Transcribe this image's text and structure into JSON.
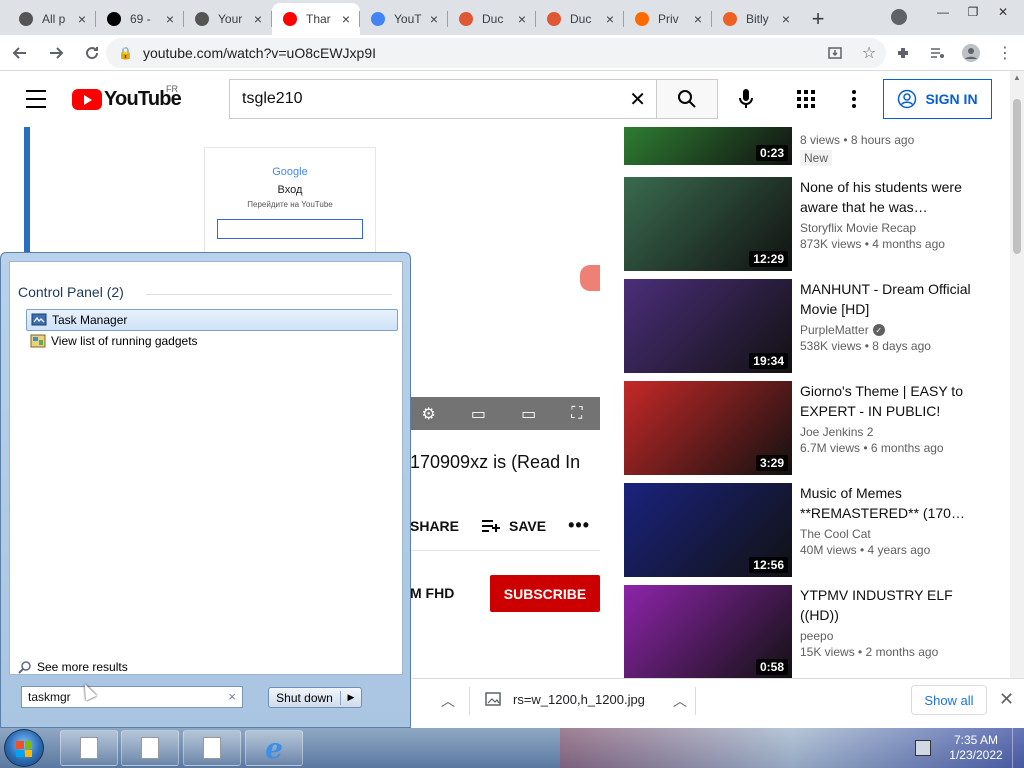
{
  "browser": {
    "tabs": [
      {
        "title": "All p",
        "icon": "tor-icon"
      },
      {
        "title": "69 -",
        "icon": "wikipedia-icon"
      },
      {
        "title": "Your",
        "icon": "tor-icon"
      },
      {
        "title": "Thar",
        "icon": "youtube-icon",
        "active": true
      },
      {
        "title": "YouT",
        "icon": "google-icon"
      },
      {
        "title": "Duc",
        "icon": "duckduckgo-icon"
      },
      {
        "title": "Duc",
        "icon": "duck-icon"
      },
      {
        "title": "Priv",
        "icon": "privacy-icon"
      },
      {
        "title": "Bitly",
        "icon": "bitly-icon"
      }
    ],
    "close_glyph": "×",
    "new_tab_glyph": "+",
    "url": "youtube.com/watch?v=uO8cEWJxp9I",
    "window_controls": [
      "—",
      "❐",
      "✕"
    ]
  },
  "youtube": {
    "logo_text": "YouTube",
    "country_code": "FR",
    "search_value": "tsgle210",
    "signin_label": "SIGN IN",
    "video_title_partial": "170909xz is (Read In",
    "actions": {
      "share": "SHARE",
      "save": "SAVE",
      "more": "•••"
    },
    "channel_partial": "M FHD",
    "subscribe_label": "SUBSCRIBE",
    "player_login": {
      "brand": "Google",
      "heading": "Вход",
      "sub": "Перейдите на YouTube"
    },
    "recommendations": [
      {
        "title": "",
        "channel": "",
        "stats": "8 views • 8 hours ago",
        "duration": "0:23",
        "badge": "New",
        "thumb_color": "#2e7d32"
      },
      {
        "title": "None of his students were aware that he was…",
        "channel": "Storyflix Movie Recap",
        "stats": "873K views • 4 months ago",
        "duration": "12:29",
        "badge": "",
        "thumb_color": "#3a6b4f"
      },
      {
        "title": "MANHUNT - Dream Official Movie [HD]",
        "channel": "PurpleMatter",
        "verified": true,
        "stats": "538K views • 8 days ago",
        "duration": "19:34",
        "badge": "",
        "thumb_color": "#4b2e7a"
      },
      {
        "title": "Giorno's Theme | EASY to EXPERT - IN PUBLIC!",
        "channel": "Joe Jenkins 2",
        "stats": "6.7M views • 6 months ago",
        "duration": "3:29",
        "badge": "",
        "thumb_color": "#c62828"
      },
      {
        "title": "Music of Memes **REMASTERED** (170…",
        "channel": "The Cool Cat",
        "stats": "40M views • 4 years ago",
        "duration": "12:56",
        "badge": "",
        "thumb_color": "#1a237e"
      },
      {
        "title": "YTPMV INDUSTRY ELF ((HD))",
        "channel": "peepo",
        "stats": "15K views • 2 months ago",
        "duration": "0:58",
        "badge": "",
        "thumb_color": "#8e24aa"
      }
    ]
  },
  "downloads": {
    "file_name": "rs=w_1200,h_1200.jpg",
    "show_all": "Show all",
    "close": "✕"
  },
  "start_menu": {
    "group_header": "Control Panel (2)",
    "results": [
      "Task Manager",
      "View list of running gadgets"
    ],
    "see_more": "See more results",
    "search_value": "taskmgr",
    "search_clear": "×",
    "shutdown_label": "Shut down",
    "shutdown_arrow": "▶"
  },
  "taskbar": {
    "time": "7:35 AM",
    "date": "1/23/2022"
  }
}
